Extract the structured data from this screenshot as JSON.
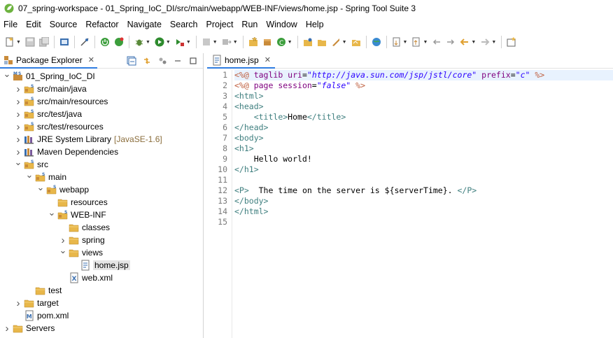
{
  "window": {
    "title": "07_spring-workspace - 01_Spring_IoC_DI/src/main/webapp/WEB-INF/views/home.jsp - Spring Tool Suite 3"
  },
  "menu": [
    "File",
    "Edit",
    "Source",
    "Refactor",
    "Navigate",
    "Search",
    "Project",
    "Run",
    "Window",
    "Help"
  ],
  "colors": {
    "accent": "#2f7de1",
    "tag": "#3f7f7f",
    "jsp_delim": "#bf5f3f",
    "attr_name": "#7f007f",
    "attr_value": "#2a00ff",
    "folder": "#e8b74a"
  },
  "package_explorer": {
    "tab_label": "Package Explorer",
    "tree": [
      {
        "label": "01_Spring_IoC_DI",
        "level": 0,
        "expanded": true,
        "icon": "project-icon"
      },
      {
        "label": "src/main/java",
        "level": 1,
        "expanded": false,
        "icon": "source-folder-icon"
      },
      {
        "label": "src/main/resources",
        "level": 1,
        "expanded": false,
        "icon": "source-folder-icon"
      },
      {
        "label": "src/test/java",
        "level": 1,
        "expanded": false,
        "icon": "source-folder-icon"
      },
      {
        "label": "src/test/resources",
        "level": 1,
        "expanded": false,
        "icon": "source-folder-icon"
      },
      {
        "label": "JRE System Library",
        "decor": "[JavaSE-1.6]",
        "level": 1,
        "expanded": false,
        "icon": "library-icon"
      },
      {
        "label": "Maven Dependencies",
        "level": 1,
        "expanded": false,
        "icon": "library-icon"
      },
      {
        "label": "src",
        "level": 1,
        "expanded": true,
        "icon": "source-folder-icon"
      },
      {
        "label": "main",
        "level": 2,
        "expanded": true,
        "icon": "source-folder-icon"
      },
      {
        "label": "webapp",
        "level": 3,
        "expanded": true,
        "icon": "source-folder-icon"
      },
      {
        "label": "resources",
        "level": 4,
        "expanded": null,
        "icon": "folder-icon"
      },
      {
        "label": "WEB-INF",
        "level": 4,
        "expanded": true,
        "icon": "source-folder-icon"
      },
      {
        "label": "classes",
        "level": 5,
        "expanded": null,
        "icon": "folder-icon"
      },
      {
        "label": "spring",
        "level": 5,
        "expanded": false,
        "icon": "folder-icon"
      },
      {
        "label": "views",
        "level": 5,
        "expanded": true,
        "icon": "folder-icon"
      },
      {
        "label": "home.jsp",
        "level": 6,
        "expanded": null,
        "icon": "jsp-file-icon",
        "selected": true
      },
      {
        "label": "web.xml",
        "level": 5,
        "expanded": null,
        "icon": "xml-file-icon"
      },
      {
        "label": "test",
        "level": 2,
        "expanded": null,
        "icon": "folder-icon"
      },
      {
        "label": "target",
        "level": 1,
        "expanded": false,
        "icon": "folder-icon"
      },
      {
        "label": "pom.xml",
        "level": 1,
        "expanded": null,
        "icon": "maven-file-icon"
      },
      {
        "label": "Servers",
        "level": 0,
        "expanded": false,
        "icon": "folder-icon"
      }
    ]
  },
  "editor": {
    "tab_label": "home.jsp",
    "current_line": 1,
    "lines": [
      [
        [
          "jsp",
          "<%@ "
        ],
        [
          "attr",
          "taglib "
        ],
        [
          "attr",
          "uri"
        ],
        [
          "txt",
          "="
        ],
        [
          "val",
          "\"http://java.sun.com/jsp/jstl/core\""
        ],
        [
          "txt",
          " "
        ],
        [
          "attr",
          "prefix"
        ],
        [
          "txt",
          "="
        ],
        [
          "val",
          "\"c\""
        ],
        [
          "txt",
          " "
        ],
        [
          "jsp",
          "%>"
        ]
      ],
      [
        [
          "jsp",
          "<%@ "
        ],
        [
          "attr",
          "page "
        ],
        [
          "attr",
          "session"
        ],
        [
          "txt",
          "="
        ],
        [
          "val",
          "\"false\""
        ],
        [
          "txt",
          " "
        ],
        [
          "jsp",
          "%>"
        ]
      ],
      [
        [
          "tag",
          "<html>"
        ]
      ],
      [
        [
          "tag",
          "<head>"
        ]
      ],
      [
        [
          "txt",
          "    "
        ],
        [
          "tag",
          "<title>"
        ],
        [
          "txt",
          "Home"
        ],
        [
          "tag",
          "</title>"
        ]
      ],
      [
        [
          "tag",
          "</head>"
        ]
      ],
      [
        [
          "tag",
          "<body>"
        ]
      ],
      [
        [
          "tag",
          "<h1>"
        ]
      ],
      [
        [
          "txt",
          "    Hello world!"
        ]
      ],
      [
        [
          "tag",
          "</h1>"
        ]
      ],
      [
        [
          "txt",
          ""
        ]
      ],
      [
        [
          "tag",
          "<P>"
        ],
        [
          "txt",
          "  The time on the server is ${serverTime}. "
        ],
        [
          "tag",
          "</P>"
        ]
      ],
      [
        [
          "tag",
          "</body>"
        ]
      ],
      [
        [
          "tag",
          "</html>"
        ]
      ],
      [
        [
          "txt",
          ""
        ]
      ]
    ]
  }
}
